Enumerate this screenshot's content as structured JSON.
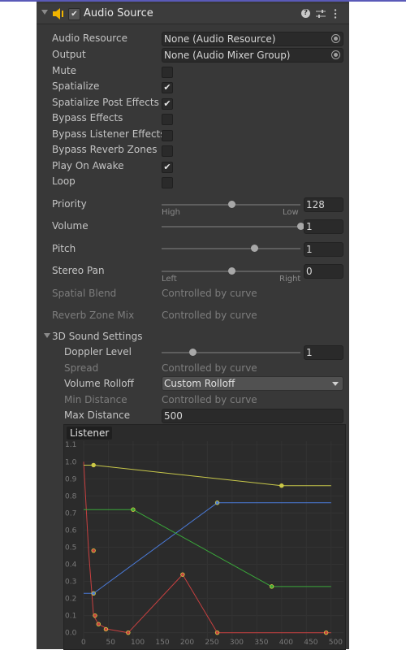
{
  "header": {
    "title": "Audio Source",
    "enabled": true
  },
  "fields": {
    "audio_resource": {
      "label": "Audio Resource",
      "value": "None (Audio Resource)"
    },
    "output": {
      "label": "Output",
      "value": "None (Audio Mixer Group)"
    },
    "mute": {
      "label": "Mute",
      "checked": false
    },
    "spatialize": {
      "label": "Spatialize",
      "checked": true
    },
    "spatialize_post": {
      "label": "Spatialize Post Effects",
      "checked": true
    },
    "bypass_effects": {
      "label": "Bypass Effects",
      "checked": false
    },
    "bypass_listener": {
      "label": "Bypass Listener Effects",
      "checked": false
    },
    "bypass_reverb": {
      "label": "Bypass Reverb Zones",
      "checked": false
    },
    "play_on_awake": {
      "label": "Play On Awake",
      "checked": true
    },
    "loop": {
      "label": "Loop",
      "checked": false
    },
    "priority": {
      "label": "Priority",
      "value": "128",
      "slider_fraction": 0.5,
      "min_label": "High",
      "max_label": "Low"
    },
    "volume": {
      "label": "Volume",
      "value": "1",
      "slider_fraction": 1.0
    },
    "pitch": {
      "label": "Pitch",
      "value": "1",
      "slider_fraction": 0.667
    },
    "stereo_pan": {
      "label": "Stereo Pan",
      "value": "0",
      "slider_fraction": 0.5,
      "min_label": "Left",
      "max_label": "Right"
    },
    "spatial_blend": {
      "label": "Spatial Blend",
      "value": "Controlled by curve"
    },
    "reverb_zone_mix": {
      "label": "Reverb Zone Mix",
      "value": "Controlled by curve"
    }
  },
  "sound3d": {
    "section_label": "3D Sound Settings",
    "doppler": {
      "label": "Doppler Level",
      "value": "1",
      "slider_fraction": 0.2
    },
    "spread": {
      "label": "Spread",
      "value": "Controlled by curve"
    },
    "volume_rolloff": {
      "label": "Volume Rolloff",
      "value": "Custom Rolloff"
    },
    "min_distance": {
      "label": "Min Distance",
      "value": "Controlled by curve"
    },
    "max_distance": {
      "label": "Max Distance",
      "value": "500"
    }
  },
  "graph": {
    "listener_label": "Listener",
    "y_ticks": [
      "1.1",
      "1.0",
      "0.9",
      "0.8",
      "0.7",
      "0.6",
      "0.5",
      "0.4",
      "0.3",
      "0.2",
      "0.1",
      "0.0"
    ],
    "x_ticks": [
      "0",
      "50",
      "100",
      "150",
      "200",
      "250",
      "300",
      "350",
      "400",
      "450",
      "500"
    ],
    "colors": {
      "volume": "#c84040",
      "spatial_blend": "#4a7ad8",
      "spread": "#3aa83a",
      "reverb": "#c8c84a"
    }
  },
  "chart_data": {
    "type": "line",
    "xlim": [
      0,
      525
    ],
    "ylim": [
      -0.03,
      1.12
    ],
    "series": [
      {
        "color": "#c84040",
        "x": [
          0,
          10,
          20,
          30,
          50,
          90,
          200,
          270,
          500
        ],
        "y": [
          1.0,
          0.48,
          0.1,
          0.05,
          0.02,
          0.0,
          0.34,
          0.0,
          0.0
        ]
      },
      {
        "color": "#4a7ad8",
        "x": [
          0,
          20,
          270,
          500
        ],
        "y": [
          0.23,
          0.23,
          0.76,
          0.76
        ]
      },
      {
        "color": "#3aa83a",
        "x": [
          0,
          20,
          100,
          380,
          500
        ],
        "y": [
          0.72,
          0.72,
          0.72,
          0.27,
          0.27
        ]
      },
      {
        "color": "#c8c84a",
        "x": [
          0,
          20,
          400,
          500
        ],
        "y": [
          0.98,
          0.98,
          0.86,
          0.86
        ]
      }
    ],
    "keyframes": [
      {
        "series": 0,
        "x": 20,
        "y": 0.48
      },
      {
        "series": 0,
        "x": 23,
        "y": 0.1
      },
      {
        "series": 0,
        "x": 30,
        "y": 0.05
      },
      {
        "series": 0,
        "x": 45,
        "y": 0.02
      },
      {
        "series": 0,
        "x": 90,
        "y": 0.0
      },
      {
        "series": 0,
        "x": 200,
        "y": 0.34
      },
      {
        "series": 0,
        "x": 270,
        "y": 0.0
      },
      {
        "series": 0,
        "x": 490,
        "y": 0.0
      },
      {
        "series": 1,
        "x": 20,
        "y": 0.23
      },
      {
        "series": 1,
        "x": 270,
        "y": 0.76
      },
      {
        "series": 2,
        "x": 100,
        "y": 0.72
      },
      {
        "series": 2,
        "x": 380,
        "y": 0.27
      },
      {
        "series": 3,
        "x": 20,
        "y": 0.98
      },
      {
        "series": 3,
        "x": 400,
        "y": 0.86
      }
    ]
  }
}
